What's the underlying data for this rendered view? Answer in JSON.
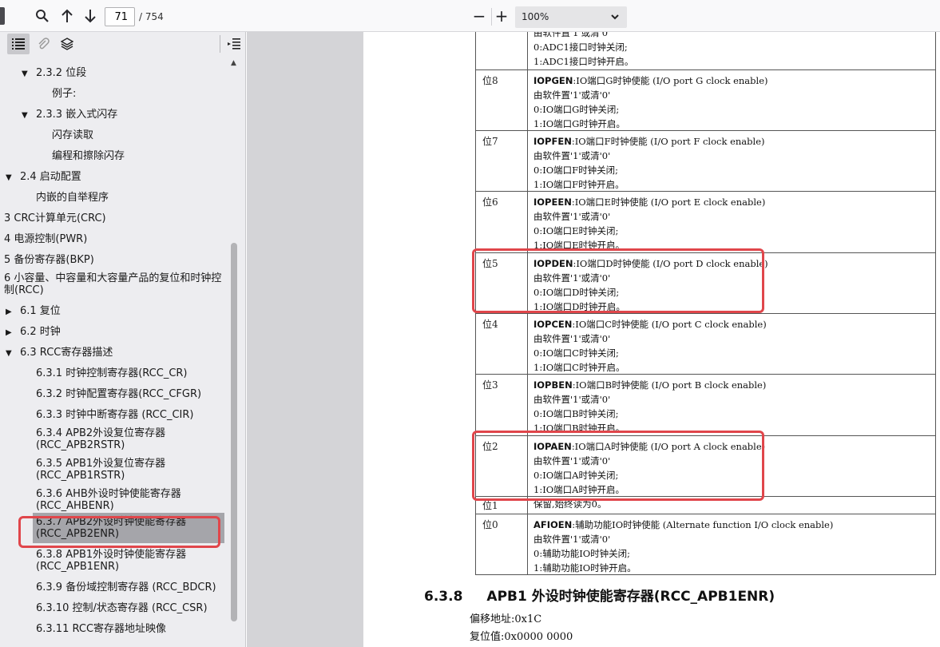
{
  "toolbar": {
    "page_number": "71",
    "page_total": "/ 754",
    "zoom": "100%",
    "zoom_out": "−",
    "zoom_in": "+"
  },
  "sidebar": {
    "outline": [
      {
        "label": "2.3.2 位段",
        "level": 1,
        "expanded": true
      },
      {
        "label": "例子:",
        "level": 2
      },
      {
        "label": "2.3.3 嵌入式闪存",
        "level": 1,
        "expanded": true
      },
      {
        "label": "闪存读取",
        "level": 2
      },
      {
        "label": "编程和擦除闪存",
        "level": 2
      },
      {
        "label": "2.4 启动配置",
        "level": 0,
        "expanded": true
      },
      {
        "label": "内嵌的自举程序",
        "level": 1
      },
      {
        "label": "3 CRC计算单元(CRC)",
        "level": -1
      },
      {
        "label": "4 电源控制(PWR)",
        "level": -1
      },
      {
        "label": "5 备份寄存器(BKP)",
        "level": -1
      },
      {
        "label": "6 小容量、中容量和大容量产品的复位和时钟控制(RCC)",
        "level": -1
      },
      {
        "label": "6.1 复位",
        "level": 0,
        "expanded": false
      },
      {
        "label": "6.2 时钟",
        "level": 0,
        "expanded": false
      },
      {
        "label": "6.3 RCC寄存器描述",
        "level": 0,
        "expanded": true
      },
      {
        "label": "6.3.1 时钟控制寄存器(RCC_CR)",
        "level": 1
      },
      {
        "label": "6.3.2 时钟配置寄存器(RCC_CFGR)",
        "level": 1
      },
      {
        "label": "6.3.3 时钟中断寄存器 (RCC_CIR)",
        "level": 1
      },
      {
        "label": "6.3.4 APB2外设复位寄存器(RCC_APB2RSTR)",
        "level": 1
      },
      {
        "label": "6.3.5 APB1外设复位寄存器(RCC_APB1RSTR)",
        "level": 1
      },
      {
        "label": "6.3.6 AHB外设时钟使能寄存器(RCC_AHBENR)",
        "level": 1
      },
      {
        "label": "6.3.7 APB2外设时钟使能寄存器(RCC_APB2ENR)",
        "level": 1,
        "selected": true
      },
      {
        "label": "6.3.8 APB1外设时钟使能寄存器(RCC_APB1ENR)",
        "level": 1
      },
      {
        "label": "6.3.9 备份域控制寄存器 (RCC_BDCR)",
        "level": 1
      },
      {
        "label": "6.3.10 控制/状态寄存器 (RCC_CSR)",
        "level": 1
      },
      {
        "label": "6.3.11 RCC寄存器地址映像",
        "level": 1
      }
    ]
  },
  "document": {
    "rows": [
      {
        "bit": "",
        "name": "",
        "title": "",
        "lines": [
          "由软件置'1'或清'0'",
          "0:ADC1接口时钟关闭;",
          "1:ADC1接口时钟开启。"
        ]
      },
      {
        "bit": "位8",
        "name": "IOPGEN",
        "title": ":IO端口G时钟使能 (I/O port G clock enable)",
        "lines": [
          "由软件置'1'或清'0'",
          "0:IO端口G时钟关闭;",
          "1:IO端口G时钟开启。"
        ]
      },
      {
        "bit": "位7",
        "name": "IOPFEN",
        "title": ":IO端口F时钟使能 (I/O port F clock enable)",
        "lines": [
          "由软件置'1'或清'0'",
          "0:IO端口F时钟关闭;",
          "1:IO端口F时钟开启。"
        ]
      },
      {
        "bit": "位6",
        "name": "IOPEEN",
        "title": ":IO端口E时钟使能 (I/O port E clock enable)",
        "lines": [
          "由软件置'1'或清'0'",
          "0:IO端口E时钟关闭;",
          "1:IO端口E时钟开启。"
        ]
      },
      {
        "bit": "位5",
        "name": "IOPDEN",
        "title": ":IO端口D时钟使能 (I/O port D clock enable)",
        "lines": [
          "由软件置'1'或清'0'",
          "0:IO端口D时钟关闭;",
          "1:IO端口D时钟开启。"
        ]
      },
      {
        "bit": "位4",
        "name": "IOPCEN",
        "title": ":IO端口C时钟使能 (I/O port C clock enable)",
        "lines": [
          "由软件置'1'或清'0'",
          "0:IO端口C时钟关闭;",
          "1:IO端口C时钟开启。"
        ]
      },
      {
        "bit": "位3",
        "name": "IOPBEN",
        "title": ":IO端口B时钟使能 (I/O port B clock enable)",
        "lines": [
          "由软件置'1'或清'0'",
          "0:IO端口B时钟关闭;",
          "1:IO端口B时钟开启。"
        ]
      },
      {
        "bit": "位2",
        "name": "IOPAEN",
        "title": ":IO端口A时钟使能 (I/O port A clock enable)",
        "lines": [
          "由软件置'1'或清'0'",
          "0:IO端口A时钟关闭;",
          "1:IO端口A时钟开启。"
        ]
      },
      {
        "bit": "位1",
        "name": "",
        "title": "保留,始终读为0。",
        "lines": []
      },
      {
        "bit": "位0",
        "name": "AFIOEN",
        "title": ":辅助功能IO时钟使能 (Alternate function I/O clock enable)",
        "lines": [
          "由软件置'1'或清'0'",
          "0:辅助功能IO时钟关闭;",
          "1:辅助功能IO时钟开启。"
        ]
      }
    ],
    "section": {
      "number": "6.3.8",
      "title": "APB1 外设时钟使能寄存器(RCC_APB1ENR)",
      "offset": "偏移地址:0x1C",
      "reset": "复位值:0x0000 0000"
    }
  },
  "colors": {
    "highlight": "#e0464b",
    "sidebar_bg": "#ededf0",
    "viewer_bg": "#d4d4d7"
  }
}
